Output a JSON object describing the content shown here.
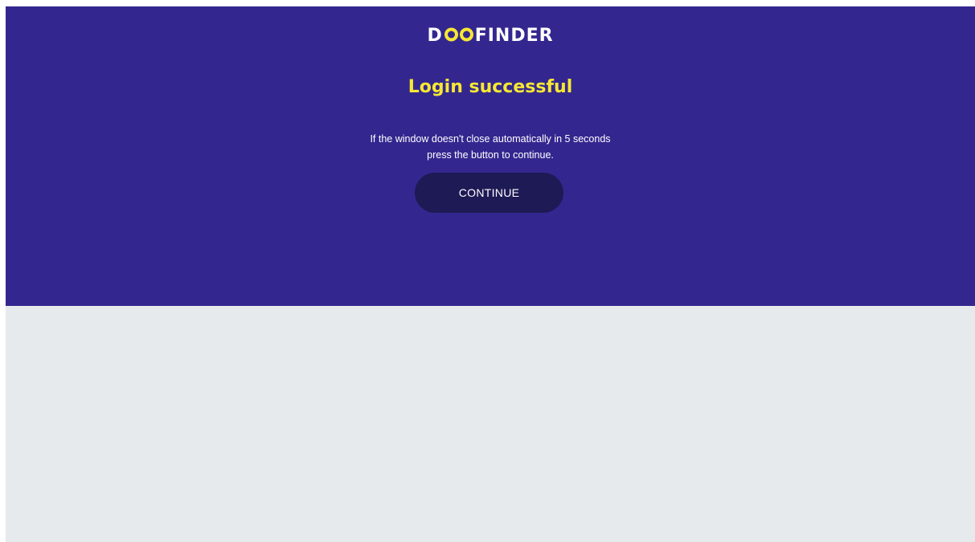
{
  "brand": {
    "logo_prefix": "D",
    "logo_suffix": "FINDER",
    "logo_icon": "infinity-eyes-icon",
    "primary_color": "#33278f",
    "accent_color": "#f7e733",
    "button_color": "#1e1a55",
    "background_color": "#e7eaed"
  },
  "page": {
    "title": "Login successful",
    "message_line1": "If the window doesn't close automatically in 5 seconds",
    "message_line2": "press the button to continue."
  },
  "actions": {
    "continue_label": "CONTINUE"
  }
}
